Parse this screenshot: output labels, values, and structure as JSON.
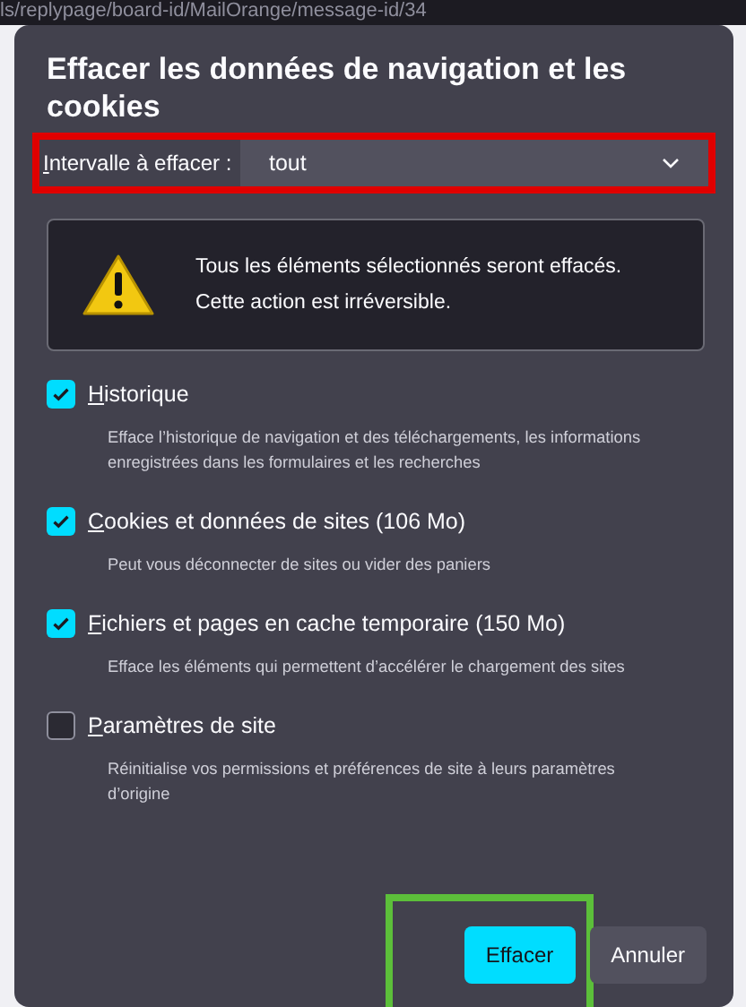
{
  "browser": {
    "url_fragment": "ls/replypage/board-id/MailOrange/message-id/34"
  },
  "dialog": {
    "title": "Effacer les données de navigation et les cookies",
    "range": {
      "label": "Intervalle à effacer :",
      "value": "tout"
    },
    "warning": {
      "lines": [
        "Tous les éléments sélectionnés seront effacés.",
        "Cette action est irréversible."
      ]
    },
    "options": [
      {
        "label": "Historique",
        "description": "Efface l’historique de navigation et des téléchargements, les informations enregistrées dans les formulaires et les recherches",
        "checked": true
      },
      {
        "label": "Cookies et données de sites (106 Mo)",
        "description": "Peut vous déconnecter de sites ou vider des paniers",
        "checked": true
      },
      {
        "label": "Fichiers et pages en cache temporaire (150 Mo)",
        "description": "Efface les éléments qui permettent d’accélérer le chargement des sites",
        "checked": true
      },
      {
        "label": "Paramètres de site",
        "description": "Réinitialise vos permissions et préférences de site à leurs paramètres d’origine",
        "checked": false
      }
    ],
    "buttons": [
      {
        "label": "Effacer",
        "kind": "primary"
      },
      {
        "label": "Annuler",
        "kind": "secondary"
      }
    ]
  },
  "annotations": [
    {
      "kind": "range",
      "color": "#e00000"
    },
    {
      "kind": "button",
      "color": "#5cbf3a"
    }
  ]
}
